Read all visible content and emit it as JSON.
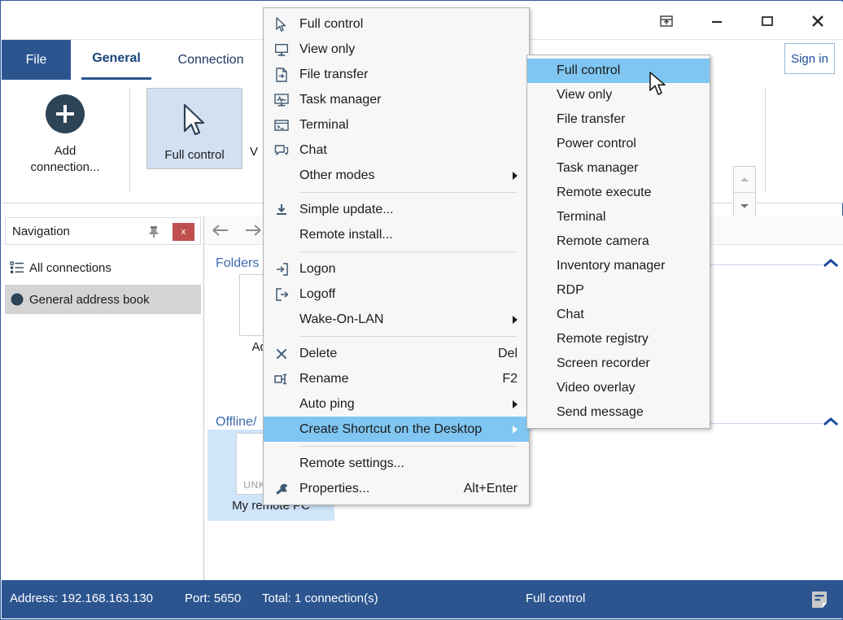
{
  "window": {
    "titlebar_buttons": [
      {
        "name": "restore-up-icon",
        "label": "Restore Up"
      },
      {
        "name": "minimize-icon",
        "label": "Minimize"
      },
      {
        "name": "maximize-icon",
        "label": "Maximize"
      },
      {
        "name": "close-icon",
        "label": "Close"
      }
    ]
  },
  "ribbon": {
    "file_tab": "File",
    "tabs": [
      {
        "label": "General",
        "active": true
      },
      {
        "label": "Connection",
        "active": false
      }
    ],
    "sign_in": "Sign in",
    "add_connection_label_line1": "Add",
    "add_connection_label_line2": "connection...",
    "tiles": [
      {
        "label": "Full control",
        "selected": true
      },
      {
        "label": "V",
        "selected": false
      }
    ]
  },
  "navigation": {
    "title": "Navigation",
    "pin_icon": "pin-icon",
    "close_label": "x",
    "items": [
      {
        "label": "All connections",
        "icon": "list-icon",
        "selected": false
      },
      {
        "label": "General address book",
        "icon": "circle-icon",
        "selected": true
      }
    ]
  },
  "content": {
    "back_arrow": "←",
    "forward_arrow": "→",
    "groups": [
      {
        "label": "Folders"
      },
      {
        "label": "Offline/"
      }
    ],
    "folder_tile": {
      "label": "Add con"
    },
    "connection_tile": {
      "thumb_text": "UNKNOWN",
      "label": "My remote PC",
      "selected": true
    }
  },
  "context_menu": {
    "items": [
      {
        "label": "Full control",
        "icon": "cursor-icon",
        "accel": "",
        "submenu": false,
        "highlight": false
      },
      {
        "label": "View only",
        "icon": "monitor-icon",
        "accel": "",
        "submenu": false,
        "highlight": false
      },
      {
        "label": "File transfer",
        "icon": "file-arrow-icon",
        "accel": "",
        "submenu": false,
        "highlight": false
      },
      {
        "label": "Task manager",
        "icon": "task-manager-icon",
        "accel": "",
        "submenu": false,
        "highlight": false
      },
      {
        "label": "Terminal",
        "icon": "terminal-icon",
        "accel": "",
        "submenu": false,
        "highlight": false
      },
      {
        "label": "Chat",
        "icon": "chat-icon",
        "accel": "",
        "submenu": false,
        "highlight": false
      },
      {
        "label": "Other modes",
        "icon": "",
        "accel": "",
        "submenu": true,
        "highlight": false
      },
      {
        "separator": true
      },
      {
        "label": "Simple update...",
        "icon": "download-icon",
        "accel": "",
        "submenu": false,
        "highlight": false
      },
      {
        "label": "Remote install...",
        "icon": "",
        "accel": "",
        "submenu": false,
        "highlight": false
      },
      {
        "separator": true
      },
      {
        "label": "Logon",
        "icon": "logon-icon",
        "accel": "",
        "submenu": false,
        "highlight": false
      },
      {
        "label": "Logoff",
        "icon": "logoff-icon",
        "accel": "",
        "submenu": false,
        "highlight": false
      },
      {
        "label": "Wake-On-LAN",
        "icon": "",
        "accel": "",
        "submenu": true,
        "highlight": false
      },
      {
        "separator": true
      },
      {
        "label": "Delete",
        "icon": "x-icon",
        "accel": "Del",
        "submenu": false,
        "highlight": false
      },
      {
        "label": "Rename",
        "icon": "rename-icon",
        "accel": "F2",
        "submenu": false,
        "highlight": false
      },
      {
        "label": "Auto ping",
        "icon": "",
        "accel": "",
        "submenu": true,
        "highlight": false
      },
      {
        "label": "Create Shortcut on the Desktop",
        "icon": "",
        "accel": "",
        "submenu": true,
        "highlight": true
      },
      {
        "separator": true
      },
      {
        "label": "Remote settings...",
        "icon": "",
        "accel": "",
        "submenu": false,
        "highlight": false
      },
      {
        "label": "Properties...",
        "icon": "wrench-icon",
        "accel": "Alt+Enter",
        "submenu": false,
        "highlight": false
      }
    ]
  },
  "submenu": {
    "items": [
      {
        "label": "Full control",
        "highlight": true
      },
      {
        "label": "View only",
        "highlight": false
      },
      {
        "label": "File transfer",
        "highlight": false
      },
      {
        "label": "Power control",
        "highlight": false
      },
      {
        "label": "Task manager",
        "highlight": false
      },
      {
        "label": "Remote execute",
        "highlight": false
      },
      {
        "label": "Terminal",
        "highlight": false
      },
      {
        "label": "Remote camera",
        "highlight": false
      },
      {
        "label": "Inventory manager",
        "highlight": false
      },
      {
        "label": "RDP",
        "highlight": false
      },
      {
        "label": "Chat",
        "highlight": false
      },
      {
        "label": "Remote registry",
        "highlight": false
      },
      {
        "label": "Screen recorder",
        "highlight": false
      },
      {
        "label": "Video overlay",
        "highlight": false
      },
      {
        "label": "Send message",
        "highlight": false
      }
    ]
  },
  "statusbar": {
    "address": "Address: 192.168.163.130",
    "port": "Port: 5650",
    "total": "Total: 1 connection(s)",
    "mode": "Full control",
    "note_icon": "note-icon"
  },
  "colors": {
    "accent_blue": "#2c5590",
    "menu_highlight": "#7fc6f2",
    "tile_selected": "#cfe5fa",
    "ribbon_tile_selected": "#d3e0f2",
    "nav_item_selected": "#d4d4d4",
    "close_red": "#c0504d",
    "group_header": "#3e6ab0"
  }
}
